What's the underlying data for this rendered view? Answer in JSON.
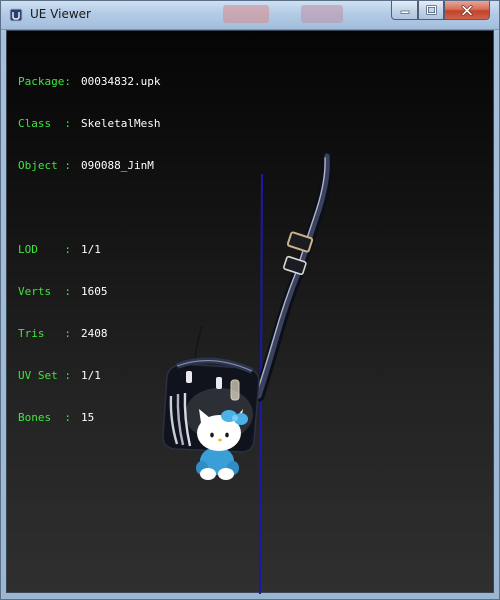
{
  "window": {
    "title": "UE Viewer",
    "icons": {
      "app": "viewer-app-icon",
      "minimize": "minimize-icon",
      "maximize": "maximize-icon",
      "close": "close-icon"
    },
    "colors": {
      "frame": "#a6c0dc",
      "close_button": "#c2432a",
      "viewport_top": "#050505",
      "viewport_bottom": "#2f2f2f"
    }
  },
  "info": {
    "package": {
      "key": "Package:",
      "value": "00034832.upk"
    },
    "class": {
      "key": "Class  :",
      "value": "SkeletalMesh"
    },
    "object": {
      "key": "Object :",
      "value": "090088_JinM"
    },
    "lod": {
      "key": "LOD    :",
      "value": "1/1"
    },
    "verts": {
      "key": "Verts  :",
      "value": "1605"
    },
    "tris": {
      "key": "Tris   :",
      "value": "2408"
    },
    "uvset": {
      "key": "UV Set :",
      "value": "1/1"
    },
    "bones": {
      "key": "Bones  :",
      "value": "15"
    },
    "colors": {
      "key": "#3fe63f",
      "value": "#ffffff"
    }
  },
  "scene": {
    "axis_color": "#1a1aa8"
  }
}
